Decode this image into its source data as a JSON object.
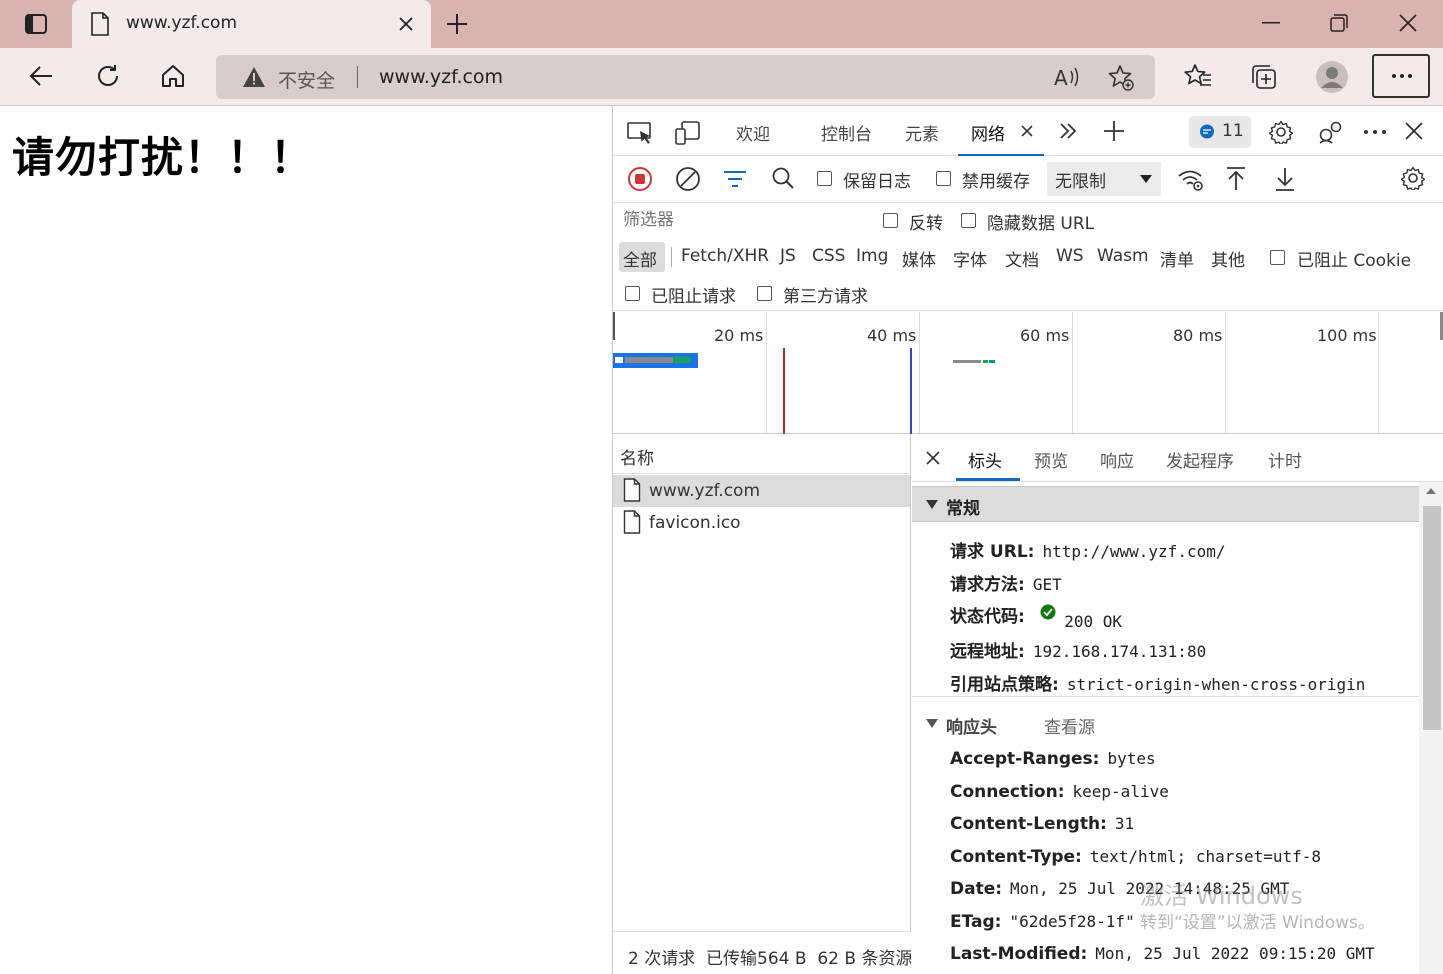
{
  "browser": {
    "tab_title": "www.yzf.com",
    "security_label": "不安全",
    "url": "www.yzf.com"
  },
  "page": {
    "heading": "请勿打扰！！！"
  },
  "devtools": {
    "tabs": [
      "欢迎",
      "控制台",
      "元素",
      "网络"
    ],
    "active_tab": "网络",
    "issues_count": "11",
    "toolbar": {
      "preserve_log": "保留日志",
      "disable_cache": "禁用缓存",
      "throttling": "无限制"
    },
    "filter": {
      "placeholder": "筛选器",
      "invert": "反转",
      "hide_data_urls": "隐藏数据 URL"
    },
    "types": [
      "全部",
      "Fetch/XHR",
      "JS",
      "CSS",
      "Img",
      "媒体",
      "字体",
      "文档",
      "WS",
      "Wasm",
      "清单",
      "其他"
    ],
    "blocked_cookies": "已阻止 Cookie",
    "blocked_requests": "已阻止请求",
    "third_party": "第三方请求",
    "timeline_ticks": [
      "20 ms",
      "40 ms",
      "60 ms",
      "80 ms",
      "100 ms"
    ],
    "list_header": "名称",
    "requests": [
      "www.yzf.com",
      "favicon.ico"
    ],
    "status_bar": "2 次请求  已传输564 B  62 B 条资源",
    "detail_tabs": [
      "标头",
      "预览",
      "响应",
      "发起程序",
      "计时"
    ],
    "general": {
      "title": "常规",
      "request_url_k": "请求 URL:",
      "request_url_v": "http://www.yzf.com/",
      "method_k": "请求方法:",
      "method_v": "GET",
      "status_k": "状态代码:",
      "status_v": "200 OK",
      "remote_k": "远程地址:",
      "remote_v": "192.168.174.131:80",
      "referrer_k": "引用站点策略:",
      "referrer_v": "strict-origin-when-cross-origin"
    },
    "response_headers": {
      "title": "响应头",
      "view_source": "查看源",
      "items": [
        {
          "k": "Accept-Ranges:",
          "v": "bytes"
        },
        {
          "k": "Connection:",
          "v": "keep-alive"
        },
        {
          "k": "Content-Length:",
          "v": "31"
        },
        {
          "k": "Content-Type:",
          "v": "text/html; charset=utf-8"
        },
        {
          "k": "Date:",
          "v": "Mon, 25 Jul 2022 14:48:25 GMT"
        },
        {
          "k": "ETag:",
          "v": "\"62de5f28-1f\""
        },
        {
          "k": "Last-Modified:",
          "v": "Mon, 25 Jul 2022 09:15:20 GMT"
        }
      ]
    }
  },
  "watermark": {
    "line1": "激活 Windows",
    "line2": "转到“设置”以激活 Windows。"
  }
}
